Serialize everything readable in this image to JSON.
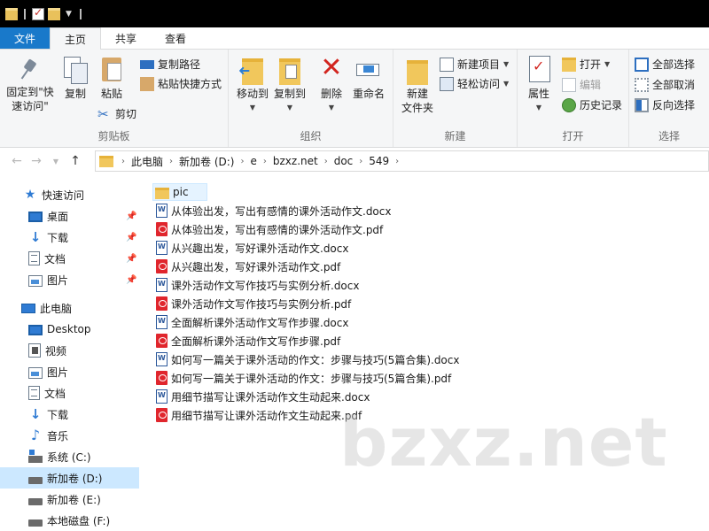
{
  "titlebar": {
    "icons": [
      "folder-icon",
      "properties-check-icon",
      "folder-icon",
      "dropdown-arrow-icon"
    ]
  },
  "tabs": {
    "file": "文件",
    "home": "主页",
    "share": "共享",
    "view": "查看"
  },
  "ribbon": {
    "clipboard": {
      "label": "剪贴板",
      "pin_line1": "固定到\"快",
      "pin_line2": "速访问\"",
      "copy": "复制",
      "paste": "粘贴",
      "copy_path": "复制路径",
      "paste_shortcut": "粘贴快捷方式",
      "cut": "剪切"
    },
    "organize": {
      "label": "组织",
      "move_to": "移动到",
      "copy_to": "复制到",
      "delete": "删除",
      "rename": "重命名"
    },
    "new": {
      "label": "新建",
      "new_folder_line1": "新建",
      "new_folder_line2": "文件夹",
      "new_item": "新建项目",
      "easy_access": "轻松访问"
    },
    "open": {
      "label": "打开",
      "properties": "属性",
      "open": "打开",
      "edit": "编辑",
      "history": "历史记录"
    },
    "select": {
      "label": "选择",
      "select_all": "全部选择",
      "select_none": "全部取消",
      "invert": "反向选择"
    }
  },
  "address": {
    "crumbs": [
      "此电脑",
      "新加卷 (D:)",
      "e",
      "bzxz.net",
      "doc",
      "549"
    ]
  },
  "sidebar": {
    "quick_access": "快速访问",
    "desktop": "桌面",
    "downloads": "下载",
    "documents": "文档",
    "pictures": "图片",
    "this_pc": "此电脑",
    "pc_desktop": "Desktop",
    "videos": "视频",
    "pc_pictures": "图片",
    "pc_documents": "文档",
    "pc_downloads": "下载",
    "music": "音乐",
    "drive_c": "系统 (C:)",
    "drive_d": "新加卷 (D:)",
    "drive_e": "新加卷 (E:)",
    "drive_f": "本地磁盘 (F:)"
  },
  "files": [
    {
      "name": "pic",
      "type": "folder"
    },
    {
      "name": "从体验出发，写出有感情的课外活动作文.docx",
      "type": "docx"
    },
    {
      "name": "从体验出发，写出有感情的课外活动作文.pdf",
      "type": "pdf"
    },
    {
      "name": "从兴趣出发，写好课外活动作文.docx",
      "type": "docx"
    },
    {
      "name": "从兴趣出发，写好课外活动作文.pdf",
      "type": "pdf"
    },
    {
      "name": "课外活动作文写作技巧与实例分析.docx",
      "type": "docx"
    },
    {
      "name": "课外活动作文写作技巧与实例分析.pdf",
      "type": "pdf"
    },
    {
      "name": "全面解析课外活动作文写作步骤.docx",
      "type": "docx"
    },
    {
      "name": "全面解析课外活动作文写作步骤.pdf",
      "type": "pdf"
    },
    {
      "name": "如何写一篇关于课外活动的作文：步骤与技巧(5篇合集).docx",
      "type": "docx"
    },
    {
      "name": "如何写一篇关于课外活动的作文：步骤与技巧(5篇合集).pdf",
      "type": "pdf"
    },
    {
      "name": "用细节描写让课外活动作文生动起来.docx",
      "type": "docx"
    },
    {
      "name": "用细节描写让课外活动作文生动起来.pdf",
      "type": "pdf"
    }
  ],
  "watermark": "bzxz.net",
  "colors": {
    "file_tab": "#1979ca",
    "selected_nav": "#cce8ff",
    "folder": "#f1c75c",
    "pdf": "#e0262d",
    "word": "#2b579a"
  }
}
